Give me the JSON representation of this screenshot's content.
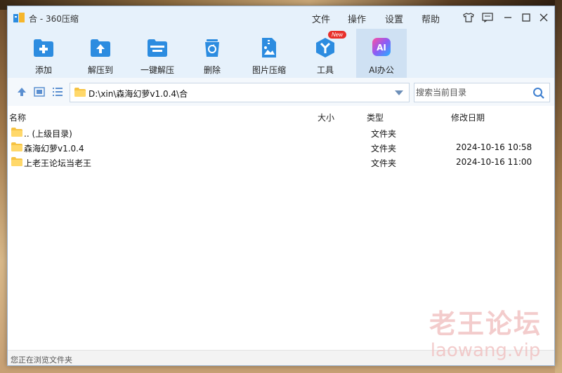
{
  "window": {
    "title": "合 - 360压缩"
  },
  "menu": {
    "file": "文件",
    "operate": "操作",
    "settings": "设置",
    "help": "帮助"
  },
  "toolbar": {
    "add": "添加",
    "extract_to": "解压到",
    "one_click_extract": "一键解压",
    "delete": "删除",
    "image_compress": "图片压缩",
    "tools": "工具",
    "tools_badge": "New",
    "ai_office": "AI办公",
    "ai_icon_text": "AI"
  },
  "nav": {
    "path": "D:\\xin\\森海幻萝v1.0.4\\合",
    "search_placeholder": "搜索当前目录"
  },
  "list": {
    "headers": {
      "name": "名称",
      "size": "大小",
      "type": "类型",
      "modified": "修改日期"
    },
    "rows": [
      {
        "name": ".. (上级目录)",
        "type": "文件夹",
        "date": ""
      },
      {
        "name": "森海幻萝v1.0.4",
        "type": "文件夹",
        "date": "2024-10-16 10:58"
      },
      {
        "name": "上老王论坛当老王",
        "type": "文件夹",
        "date": "2024-10-16 11:00"
      }
    ]
  },
  "status": {
    "text": "您正在浏览文件夹"
  },
  "watermark": {
    "cn": "老王论坛",
    "en": "laowang.vip"
  },
  "colors": {
    "accent": "#2c8ce0",
    "titlebar": "#e6f1fb",
    "folder": "#f6c342",
    "badge": "#e8302b"
  }
}
